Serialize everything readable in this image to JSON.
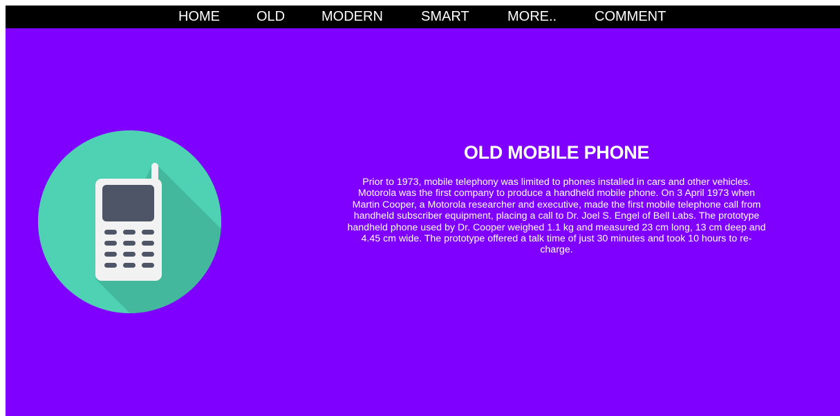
{
  "nav": {
    "items": [
      {
        "id": "home",
        "label": "HOME"
      },
      {
        "id": "old",
        "label": "OLD"
      },
      {
        "id": "modern",
        "label": "MODERN"
      },
      {
        "id": "smart",
        "label": "SMART"
      },
      {
        "id": "more",
        "label": "MORE.."
      },
      {
        "id": "comment",
        "label": "COMMENT"
      }
    ]
  },
  "hero": {
    "icon": "mobile-phone-icon",
    "title": "OLD MOBILE PHONE",
    "description": "Prior to 1973, mobile telephony was limited to phones installed in cars and other vehicles. Motorola was the first company to produce a handheld mobile phone. On 3 April 1973 when Martin Cooper, a Motorola researcher and executive, made the first mobile telephone call from handheld subscriber equipment, placing a call to Dr. Joel S. Engel of Bell Labs. The prototype handheld phone used by Dr. Cooper weighed 1.1 kg and measured 23 cm long, 13 cm deep and 4.45 cm wide. The prototype offered a talk time of just 30 minutes and took 10 hours to re-charge."
  },
  "colors": {
    "background": "#7f00ff",
    "navbar": "#000000",
    "icon_circle": "#4fd1b4",
    "icon_shadow": "#43b89c",
    "phone_body": "#f2f2f2",
    "phone_screen": "#4d5567"
  }
}
